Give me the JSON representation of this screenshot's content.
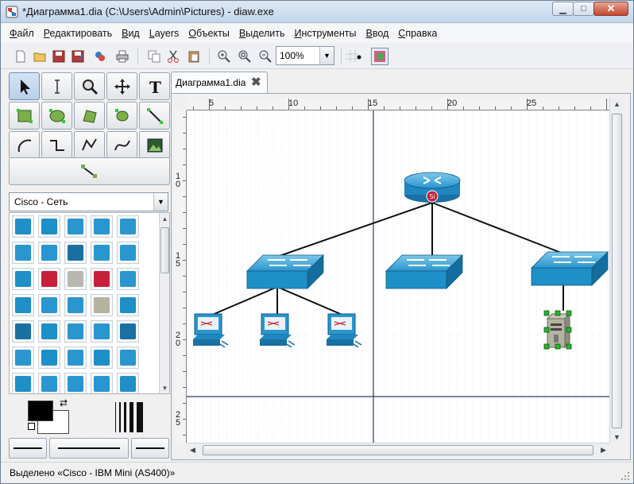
{
  "window": {
    "title": "*Диаграмма1.dia (C:\\Users\\Admin\\Pictures) - diaw.exe",
    "controls": [
      "minimize",
      "maximize",
      "close"
    ]
  },
  "menu": [
    "Файл",
    "Редактировать",
    "Вид",
    "Layers",
    "Объекты",
    "Выделить",
    "Инструменты",
    "Ввод",
    "Справка"
  ],
  "toolbar": {
    "zoom_value": "100%",
    "icons": [
      "new-icon",
      "open-icon",
      "save-icon",
      "save-as-icon",
      "export-icon",
      "print-icon",
      "copy-icon",
      "cut-icon",
      "paste-icon",
      "zoom-in-icon",
      "zoom-fit-icon",
      "zoom-out-icon",
      "snap-grid-icon",
      "snap-point-icon",
      "layer-toggle-icon"
    ]
  },
  "toolbox": {
    "tools": [
      "pointer",
      "text-edit",
      "magnify",
      "scroll",
      "text",
      "box",
      "ellipse",
      "polygon",
      "beziergon",
      "line",
      "arc",
      "zigzag",
      "polyline",
      "bezier",
      "image"
    ],
    "sheet": "Cisco - Сеть"
  },
  "document": {
    "tab_label": "Диаграмма1.dia",
    "h_ruler": [
      "5",
      "10",
      "15",
      "20",
      "25"
    ],
    "v_ruler": [
      "1\n0",
      "1\n5",
      "2\n0",
      "2\n5"
    ],
    "nodes": [
      {
        "id": "router",
        "type": "cisco-router",
        "label": "Si"
      },
      {
        "id": "switch-left",
        "type": "cisco-switch"
      },
      {
        "id": "switch-mid",
        "type": "cisco-switch"
      },
      {
        "id": "switch-right",
        "type": "cisco-switch"
      },
      {
        "id": "pc-1",
        "type": "cisco-workstation"
      },
      {
        "id": "pc-2",
        "type": "cisco-workstation"
      },
      {
        "id": "pc-3",
        "type": "cisco-workstation"
      },
      {
        "id": "server-as400",
        "type": "cisco-ibm-mini",
        "selected": true
      }
    ],
    "connections": [
      [
        "router",
        "switch-left"
      ],
      [
        "router",
        "switch-mid"
      ],
      [
        "router",
        "switch-right"
      ],
      [
        "switch-left",
        "pc-1"
      ],
      [
        "switch-left",
        "pc-2"
      ],
      [
        "switch-left",
        "pc-3"
      ],
      [
        "switch-right",
        "server-as400"
      ]
    ]
  },
  "status": {
    "text": "Выделено «Cisco - IBM Mini (AS400)»"
  },
  "colors": {
    "device_blue": "#1f8fc7",
    "selection_green": "#27b327",
    "router_badge": "#c8203a"
  }
}
